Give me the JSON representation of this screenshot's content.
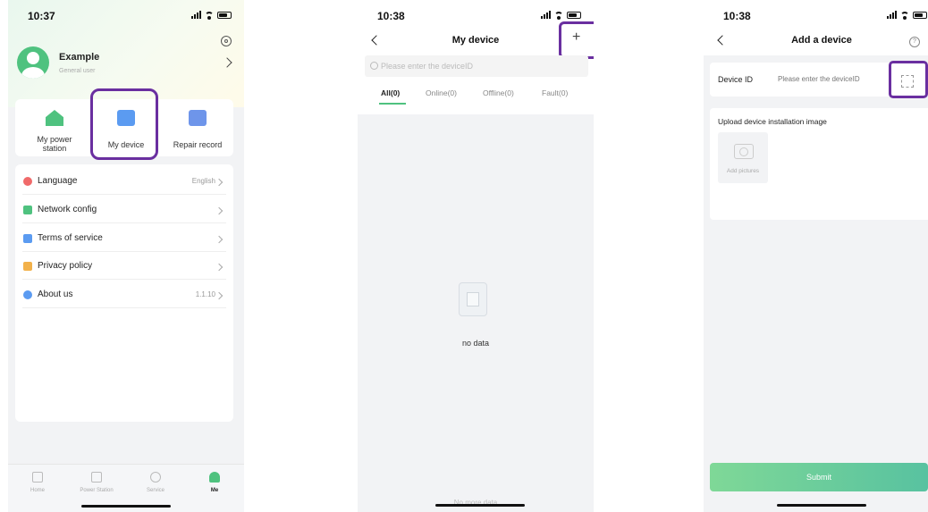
{
  "screen1": {
    "status_time": "10:37",
    "user": {
      "name": "Example",
      "role": "General user"
    },
    "quick_actions": [
      {
        "label": "My power\nstation",
        "icon": "power-station-icon"
      },
      {
        "label": "My device",
        "icon": "device-icon"
      },
      {
        "label": "Repair record",
        "icon": "repair-record-icon"
      }
    ],
    "menu": [
      {
        "label": "Language",
        "value": "English",
        "icon": "globe-icon",
        "color": "#f06a6a"
      },
      {
        "label": "Network config",
        "value": "",
        "icon": "network-icon",
        "color": "#4fc27f"
      },
      {
        "label": "Terms of service",
        "value": "",
        "icon": "document-icon",
        "color": "#5b9bf1"
      },
      {
        "label": "Privacy policy",
        "value": "",
        "icon": "lock-icon",
        "color": "#f2b14a"
      },
      {
        "label": "About us",
        "value": "1.1.10",
        "icon": "info-icon",
        "color": "#5b9bf1"
      }
    ],
    "tabbar": [
      {
        "label": "Home",
        "icon": "home-icon"
      },
      {
        "label": "Power Station",
        "icon": "power-station-icon"
      },
      {
        "label": "Service",
        "icon": "service-icon"
      },
      {
        "label": "Me",
        "icon": "user-icon",
        "active": true
      }
    ]
  },
  "screen2": {
    "status_time": "10:38",
    "title": "My device",
    "add_label": "+",
    "search_placeholder": "Please enter the deviceID",
    "tabs": [
      "All(0)",
      "Online(0)",
      "Offline(0)",
      "Fault(0)"
    ],
    "empty_text": "no data",
    "footer_text": "No more data"
  },
  "screen3": {
    "status_time": "10:38",
    "title": "Add a device",
    "help_label": "?",
    "device_id_label": "Device ID",
    "device_id_placeholder": "Please enter the deviceID",
    "upload_label": "Upload device installation image",
    "add_pictures_label": "Add pictures",
    "submit_label": "Submit"
  },
  "colors": {
    "accent": "#4fc27f",
    "highlight": "#6a2fa0"
  }
}
